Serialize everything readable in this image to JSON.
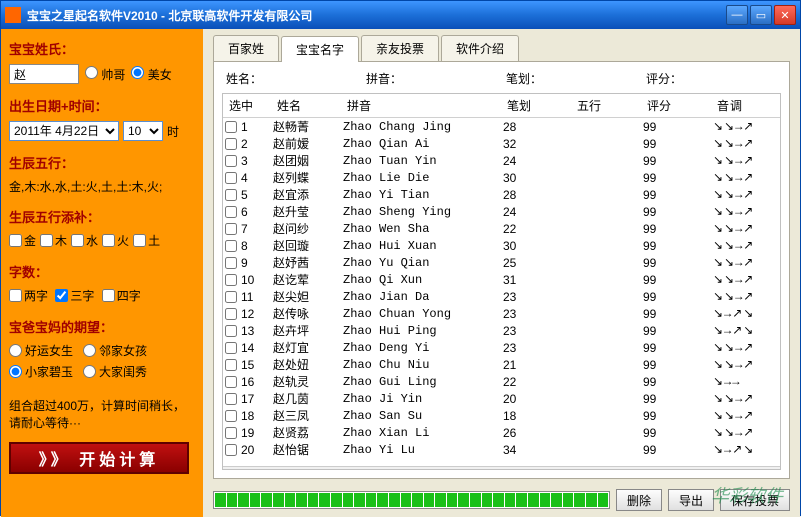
{
  "window": {
    "title": "宝宝之星起名软件V2010 - 北京联高软件开发有限公司"
  },
  "sidebar": {
    "surname_label": "宝宝姓氏：",
    "surname_value": "赵",
    "gender": {
      "boy": "帅哥",
      "girl": "美女",
      "selected": "girl"
    },
    "birth_label": "出生日期+时间：",
    "date_value": "2011年 4月22日",
    "hour_value": "10",
    "hour_suffix": "时",
    "wuxing_label": "生辰五行：",
    "wuxing_text": "金,木:水,水,土:火,土,土:木,火;",
    "wuxing_fill_label": "生辰五行添补：",
    "wuxing_opts": [
      "金",
      "木",
      "水",
      "火",
      "土"
    ],
    "chars_label": "字数：",
    "chars_opts": {
      "two": "两字",
      "three": "三字",
      "four": "四字"
    },
    "hope_label": "宝爸宝妈的期望：",
    "hope_opts": {
      "a": "好运女生",
      "b": "邻家女孩",
      "c": "小家碧玉",
      "d": "大家闺秀"
    },
    "hint": "组合超过400万，计算时间稍长，请耐心等待···",
    "start_btn": "》》 开始计算"
  },
  "tabs": {
    "items": [
      "百家姓",
      "宝宝名字",
      "亲友投票",
      "软件介绍"
    ],
    "active": 1
  },
  "filter": {
    "name_lbl": "姓名：",
    "py_lbl": "拼音：",
    "stroke_lbl": "笔划：",
    "score_lbl": "评分："
  },
  "columns": {
    "sel": "选中",
    "name": "姓名",
    "py": "拼音",
    "stroke": "笔划",
    "wx": "五行",
    "score": "评分",
    "tone": "音调"
  },
  "rows": [
    {
      "n": 1,
      "name": "赵畅菁",
      "py": "Zhao Chang Jing",
      "stroke": 28,
      "score": 99,
      "tone": "↘↘→↗"
    },
    {
      "n": 2,
      "name": "赵前嫒",
      "py": "Zhao Qian Ai",
      "stroke": 32,
      "score": 99,
      "tone": "↘↘→↗"
    },
    {
      "n": 3,
      "name": "赵团姻",
      "py": "Zhao Tuan Yin",
      "stroke": 24,
      "score": 99,
      "tone": "↘↘→↗"
    },
    {
      "n": 4,
      "name": "赵列蝶",
      "py": "Zhao Lie Die",
      "stroke": 30,
      "score": 99,
      "tone": "↘↘→↗"
    },
    {
      "n": 5,
      "name": "赵宜添",
      "py": "Zhao Yi Tian",
      "stroke": 28,
      "score": 99,
      "tone": "↘↘→↗"
    },
    {
      "n": 6,
      "name": "赵升莹",
      "py": "Zhao Sheng Ying",
      "stroke": 24,
      "score": 99,
      "tone": "↘↘→↗"
    },
    {
      "n": 7,
      "name": "赵问纱",
      "py": "Zhao Wen Sha",
      "stroke": 22,
      "score": 99,
      "tone": "↘↘→↗"
    },
    {
      "n": 8,
      "name": "赵回璇",
      "py": "Zhao Hui Xuan",
      "stroke": 30,
      "score": 99,
      "tone": "↘↘→↗"
    },
    {
      "n": 9,
      "name": "赵妤茜",
      "py": "Zhao Yu Qian",
      "stroke": 25,
      "score": 99,
      "tone": "↘↘→↗"
    },
    {
      "n": 10,
      "name": "赵讫荤",
      "py": "Zhao Qi Xun",
      "stroke": 31,
      "score": 99,
      "tone": "↘↘→↗"
    },
    {
      "n": 11,
      "name": "赵尖妲",
      "py": "Zhao Jian Da",
      "stroke": 23,
      "score": 99,
      "tone": "↘↘→↗"
    },
    {
      "n": 12,
      "name": "赵传咏",
      "py": "Zhao Chuan Yong",
      "stroke": 23,
      "score": 99,
      "tone": "↘→↗↘"
    },
    {
      "n": 13,
      "name": "赵卉坪",
      "py": "Zhao Hui Ping",
      "stroke": 23,
      "score": 99,
      "tone": "↘→↗↘"
    },
    {
      "n": 14,
      "name": "赵灯宜",
      "py": "Zhao Deng Yi",
      "stroke": 23,
      "score": 99,
      "tone": "↘↘→↗"
    },
    {
      "n": 15,
      "name": "赵处妞",
      "py": "Zhao Chu Niu",
      "stroke": 21,
      "score": 99,
      "tone": "↘↘→↗"
    },
    {
      "n": 16,
      "name": "赵轨灵",
      "py": "Zhao Gui Ling",
      "stroke": 22,
      "score": 99,
      "tone": "↘→→"
    },
    {
      "n": 17,
      "name": "赵几茵",
      "py": "Zhao Ji Yin",
      "stroke": 20,
      "score": 99,
      "tone": "↘↘→↗"
    },
    {
      "n": 18,
      "name": "赵三凤",
      "py": "Zhao San Su",
      "stroke": 18,
      "score": 99,
      "tone": "↘↘→↗"
    },
    {
      "n": 19,
      "name": "赵贤荔",
      "py": "Zhao Xian Li",
      "stroke": 26,
      "score": 99,
      "tone": "↘↘→↗"
    },
    {
      "n": 20,
      "name": "赵怡锯",
      "py": "Zhao Yi Lu",
      "stroke": 34,
      "score": 99,
      "tone": "↘→↗↘"
    }
  ],
  "buttons": {
    "delete": "删除",
    "export": "导出",
    "save_vote": "保存投票"
  },
  "watermark": "华彩软件"
}
